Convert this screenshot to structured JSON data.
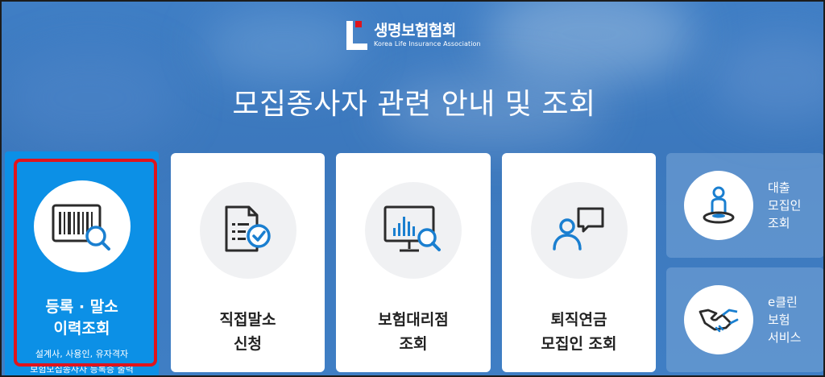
{
  "logo": {
    "name_ko": "생명보험협회",
    "name_en": "Korea Life Insurance Association"
  },
  "headline": "모집종사자 관련 안내 및 조회",
  "cards": [
    {
      "label": "등록 · 말소\n이력조회",
      "sub": "설계사, 사용인, 유자격자\n보험모집종사자 등록증 출력",
      "icon": "barcode-search-icon"
    },
    {
      "label": "직접말소\n신청",
      "icon": "document-check-icon"
    },
    {
      "label": "보험대리점\n조회",
      "icon": "monitor-chart-search-icon"
    },
    {
      "label": "퇴직연금\n모집인 조회",
      "icon": "person-speech-icon"
    }
  ],
  "side": [
    {
      "label": "대출\n모집인\n조회",
      "icon": "person-location-icon"
    },
    {
      "label": "e클린\n보험\n서비스",
      "icon": "handshake-icon"
    }
  ],
  "colors": {
    "accent": "#0c90e6",
    "highlight": "#e0141c",
    "icon": "#2f6fae"
  }
}
